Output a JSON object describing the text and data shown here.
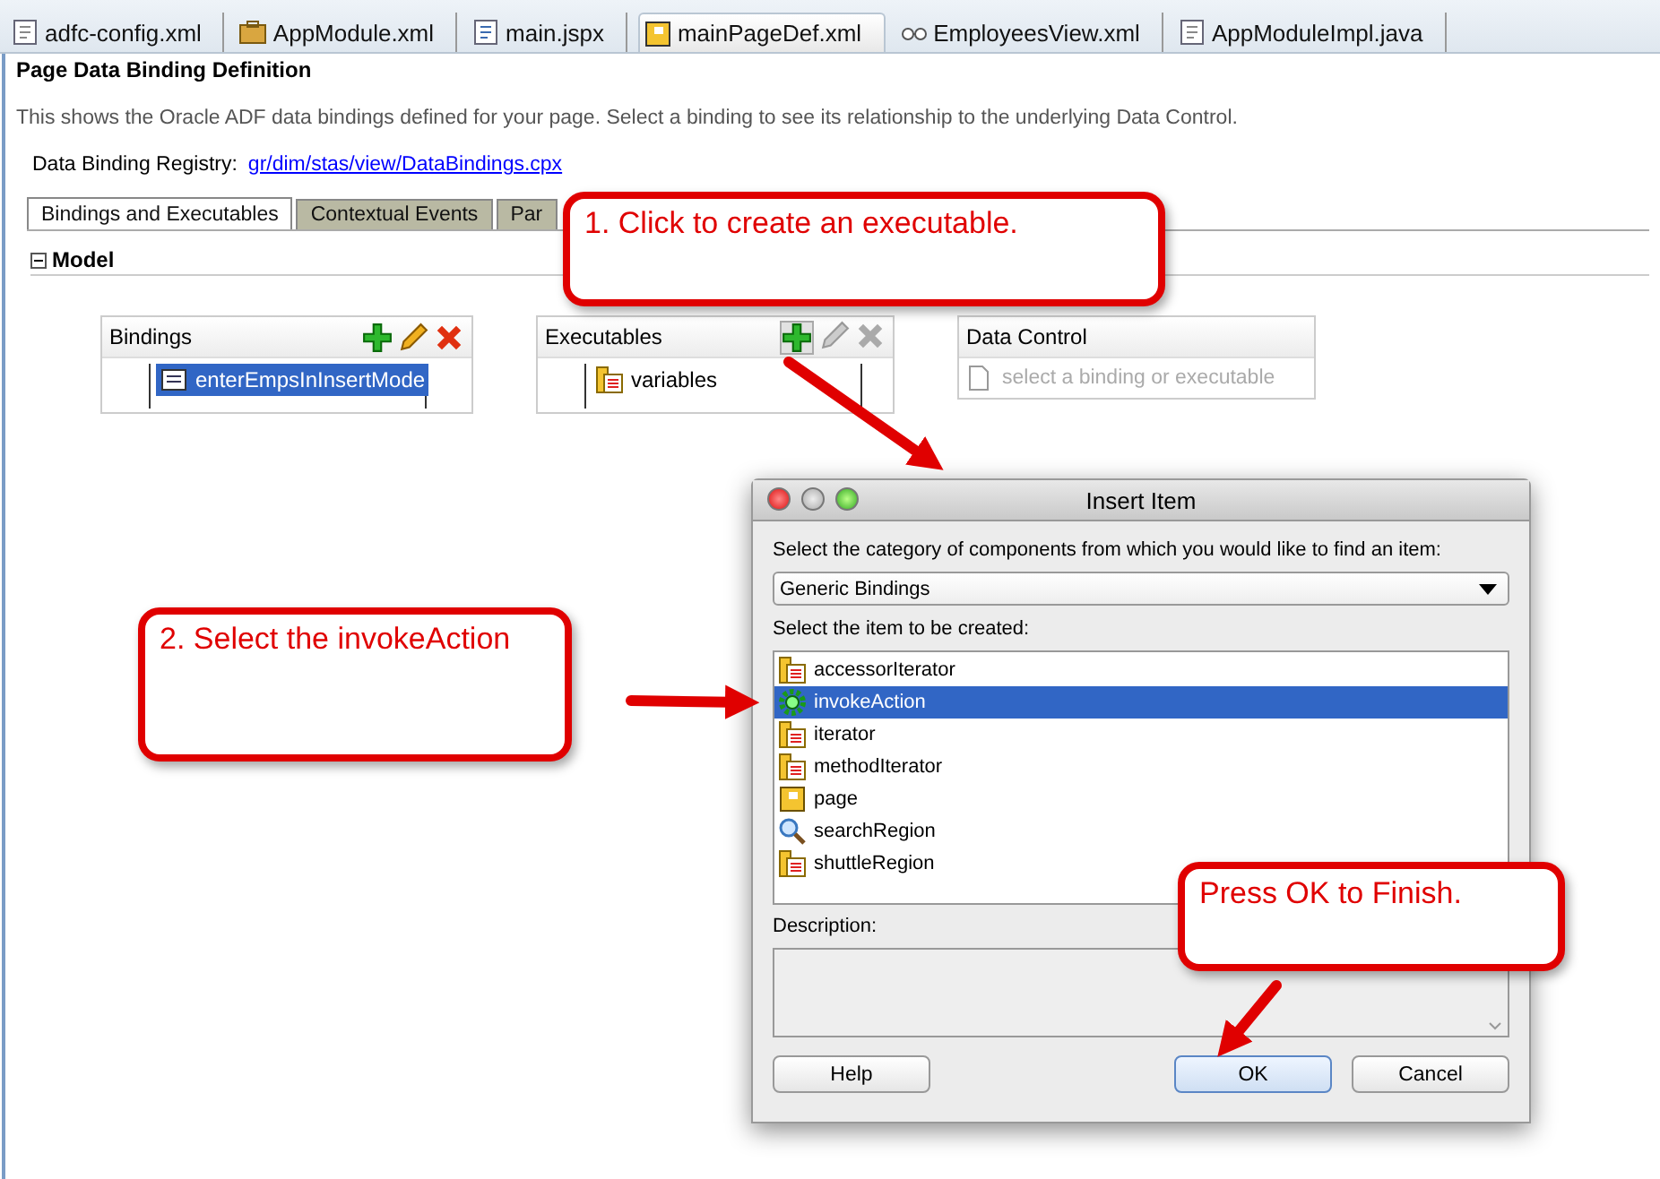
{
  "editor_tabs": [
    {
      "label": "adfc-config.xml",
      "kind": "config",
      "selected": false
    },
    {
      "label": "AppModule.xml",
      "kind": "module",
      "selected": false
    },
    {
      "label": "main.jspx",
      "kind": "jspx",
      "selected": false
    },
    {
      "label": "mainPageDef.xml",
      "kind": "page",
      "selected": true
    },
    {
      "label": "EmployeesView.xml",
      "kind": "view",
      "selected": false
    },
    {
      "label": "AppModuleImpl.java",
      "kind": "java",
      "selected": false
    }
  ],
  "page": {
    "title": "Page Data Binding Definition",
    "description": "This shows the Oracle ADF data bindings defined for your page. Select a binding to see its relationship to the underlying Data Control.",
    "registry_label": "Data Binding Registry:",
    "registry_link": "gr/dim/stas/view/DataBindings.cpx"
  },
  "inner_tabs": [
    {
      "label": "Bindings and Executables",
      "selected": true
    },
    {
      "label": "Contextual Events",
      "selected": false
    },
    {
      "label": "Par",
      "selected": false
    }
  ],
  "model": {
    "label": "Model",
    "expanded": true
  },
  "bindings_panel": {
    "title": "Bindings",
    "items": [
      {
        "label": "enterEmpsInInsertMode",
        "selected": true
      }
    ]
  },
  "executables_panel": {
    "title": "Executables",
    "items": [
      {
        "label": "variables",
        "selected": false
      }
    ]
  },
  "data_control_panel": {
    "title": "Data Control",
    "placeholder": "select a binding or executable"
  },
  "dialog": {
    "title": "Insert Item",
    "category_label": "Select the category of components from which you would like to find an item:",
    "category_value": "Generic Bindings",
    "item_label": "Select the item to be created:",
    "items": [
      {
        "label": "accessorIterator",
        "kind": "iterator",
        "selected": false
      },
      {
        "label": "invokeAction",
        "kind": "gear",
        "selected": true
      },
      {
        "label": "iterator",
        "kind": "iterator",
        "selected": false
      },
      {
        "label": "methodIterator",
        "kind": "iterator",
        "selected": false
      },
      {
        "label": "page",
        "kind": "page",
        "selected": false
      },
      {
        "label": "searchRegion",
        "kind": "search",
        "selected": false
      },
      {
        "label": "shuttleRegion",
        "kind": "iterator",
        "selected": false
      }
    ],
    "description_label": "Description:",
    "buttons": [
      "Help",
      "OK",
      "Cancel"
    ]
  },
  "callouts": [
    {
      "text": "1. Click to create an executable."
    },
    {
      "text": "2. Select the invokeAction"
    },
    {
      "text": "Press OK to Finish."
    }
  ]
}
